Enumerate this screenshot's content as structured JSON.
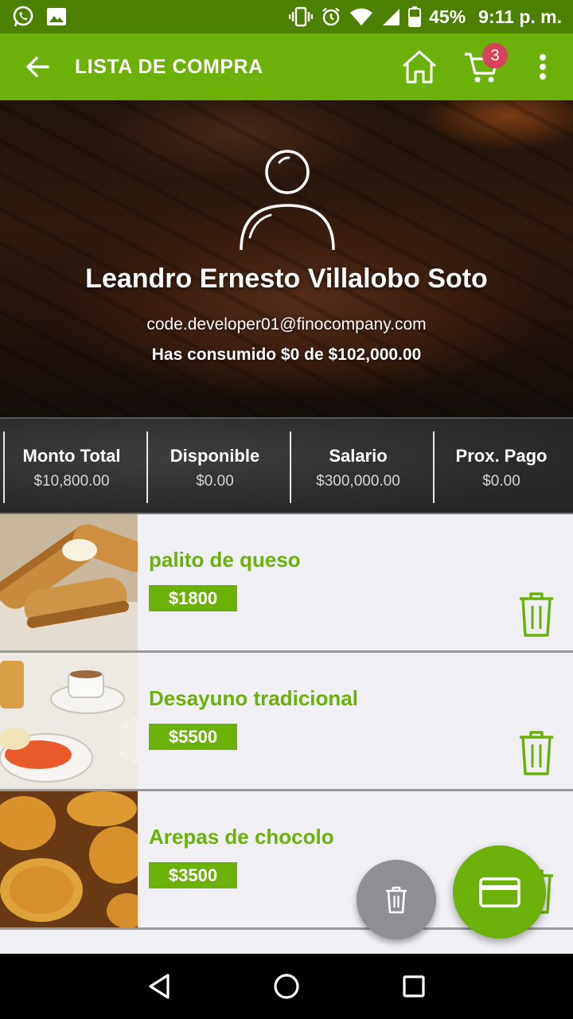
{
  "status_bar": {
    "battery": "45%",
    "time": "9:11 p. m."
  },
  "appbar": {
    "title": "LISTA DE COMPRA",
    "cart_count": "3"
  },
  "profile": {
    "name": "Leandro Ernesto Villalobo Soto",
    "email": "code.developer01@finocompany.com",
    "consumed": "Has consumido $0 de $102,000.00"
  },
  "stats": [
    {
      "label": "Monto Total",
      "value": "$10,800.00"
    },
    {
      "label": "Disponible",
      "value": "$0.00"
    },
    {
      "label": "Salario",
      "value": "$300,000.00"
    },
    {
      "label": "Prox. Pago",
      "value": "$0.00"
    }
  ],
  "items": [
    {
      "name": "palito de queso",
      "price": "$1800"
    },
    {
      "name": "Desayuno tradicional",
      "price": "$5500"
    },
    {
      "name": "Arepas de chocolo",
      "price": "$3500"
    }
  ],
  "colors": {
    "brand_green": "#6bb10a",
    "status_green": "#4d7f00",
    "badge_red": "#d6435b",
    "fab_gray": "#8e8e93"
  },
  "icons": [
    "whatsapp-icon",
    "gallery-icon",
    "vibrate-icon",
    "alarm-icon",
    "wifi-icon",
    "signal-icon",
    "battery-icon",
    "back-arrow-icon",
    "home-icon",
    "cart-icon",
    "more-vert-icon",
    "avatar-icon",
    "trash-icon",
    "credit-card-icon",
    "nav-back-icon",
    "nav-home-icon",
    "nav-recents-icon"
  ]
}
